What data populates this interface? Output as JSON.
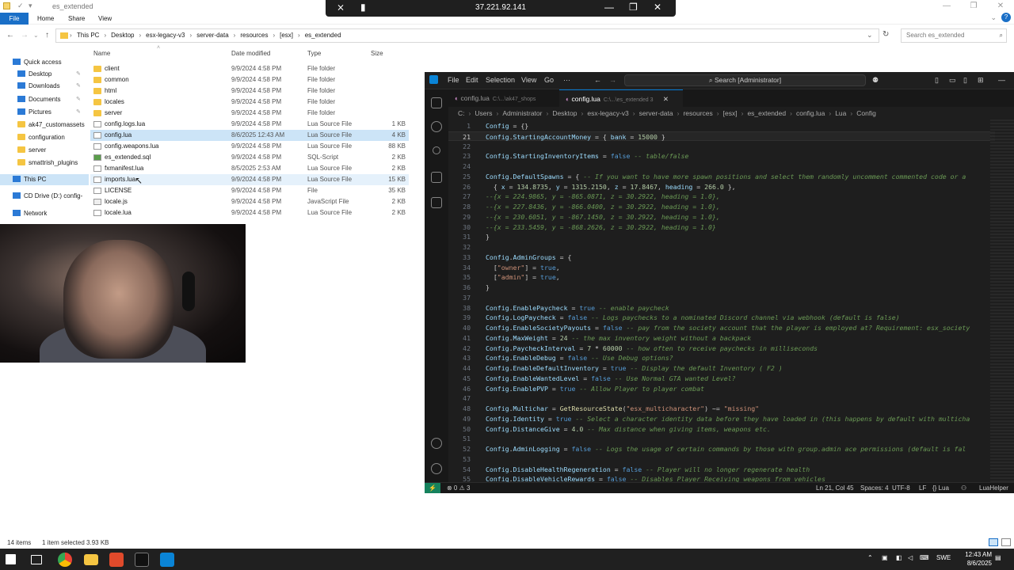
{
  "explorer": {
    "window_title": "es_extended",
    "ribbon_tabs": [
      "File",
      "Home",
      "Share",
      "View"
    ],
    "window_controls": {
      "minimize": "—",
      "restore": "❐",
      "close": "✕"
    },
    "address": {
      "crumbs": [
        "This PC",
        "Desktop",
        "esx-legacy-v3",
        "server-data",
        "resources",
        "[esx]",
        "es_extended"
      ],
      "separator": "›"
    },
    "search_placeholder": "Search es_extended",
    "nav_items": [
      {
        "label": "Quick access",
        "icon": "star-icon"
      },
      {
        "label": "Desktop",
        "icon": "desktop-icon",
        "pinned": true
      },
      {
        "label": "Downloads",
        "icon": "downloads-icon",
        "pinned": true
      },
      {
        "label": "Documents",
        "icon": "documents-icon",
        "pinned": true
      },
      {
        "label": "Pictures",
        "icon": "pictures-icon",
        "pinned": true
      },
      {
        "label": "ak47_customassets",
        "icon": "folder-icon"
      },
      {
        "label": "configuration",
        "icon": "folder-icon"
      },
      {
        "label": "server",
        "icon": "folder-icon"
      },
      {
        "label": "smattrish_plugins",
        "icon": "folder-icon"
      },
      {
        "label": "This PC",
        "icon": "computer-icon"
      },
      {
        "label": "CD Drive (D:) config-",
        "icon": "disc-icon"
      },
      {
        "label": "Network",
        "icon": "network-icon"
      }
    ],
    "columns": {
      "name": "Name",
      "date": "Date modified",
      "type": "Type",
      "size": "Size"
    },
    "files": [
      {
        "name": "client",
        "date": "9/9/2024 4:58 PM",
        "type": "File folder",
        "size": "",
        "icon": "folder-icon"
      },
      {
        "name": "common",
        "date": "9/9/2024 4:58 PM",
        "type": "File folder",
        "size": "",
        "icon": "folder-icon"
      },
      {
        "name": "html",
        "date": "9/9/2024 4:58 PM",
        "type": "File folder",
        "size": "",
        "icon": "folder-icon"
      },
      {
        "name": "locales",
        "date": "9/9/2024 4:58 PM",
        "type": "File folder",
        "size": "",
        "icon": "folder-icon"
      },
      {
        "name": "server",
        "date": "9/9/2024 4:58 PM",
        "type": "File folder",
        "size": "",
        "icon": "folder-icon"
      },
      {
        "name": "config.logs.lua",
        "date": "9/9/2024 4:58 PM",
        "type": "Lua Source File",
        "size": "1 KB",
        "icon": "lua-file-icon"
      },
      {
        "name": "config.lua",
        "date": "8/6/2025 12:43 AM",
        "type": "Lua Source File",
        "size": "4 KB",
        "icon": "lua-file-icon"
      },
      {
        "name": "config.weapons.lua",
        "date": "9/9/2024 4:58 PM",
        "type": "Lua Source File",
        "size": "88 KB",
        "icon": "lua-file-icon"
      },
      {
        "name": "es_extended.sql",
        "date": "9/9/2024 4:58 PM",
        "type": "SQL-Script",
        "size": "2 KB",
        "icon": "sql-file-icon"
      },
      {
        "name": "fxmanifest.lua",
        "date": "8/5/2025 2:53 AM",
        "type": "Lua Source File",
        "size": "2 KB",
        "icon": "lua-file-icon"
      },
      {
        "name": "imports.lua",
        "date": "9/9/2024 4:58 PM",
        "type": "Lua Source File",
        "size": "15 KB",
        "icon": "lua-file-icon"
      },
      {
        "name": "LICENSE",
        "date": "9/9/2024 4:58 PM",
        "type": "File",
        "size": "35 KB",
        "icon": "file-icon"
      },
      {
        "name": "locale.js",
        "date": "9/9/2024 4:58 PM",
        "type": "JavaScript File",
        "size": "2 KB",
        "icon": "js-file-icon"
      },
      {
        "name": "locale.lua",
        "date": "9/9/2024 4:58 PM",
        "type": "Lua Source File",
        "size": "2 KB",
        "icon": "lua-file-icon"
      }
    ],
    "status": {
      "items": "14 items",
      "selected": "1 item selected  3.93 KB"
    }
  },
  "remote": {
    "ip": "37.221.92.141"
  },
  "vscode": {
    "menu": [
      "File",
      "Edit",
      "Selection",
      "View",
      "Go",
      "···"
    ],
    "search": "Search [Administrator]",
    "tabs": [
      {
        "name": "config.lua",
        "path": "C:\\...\\ak47_shops",
        "active": false
      },
      {
        "name": "config.lua",
        "path": "C:\\...\\es_extended 3",
        "active": true
      }
    ],
    "breadcrumb": [
      "C:",
      "Users",
      "Administrator",
      "Desktop",
      "esx-legacy-v3",
      "server-data",
      "resources",
      "[esx]",
      "es_extended",
      "config.lua",
      "Lua",
      "Config"
    ],
    "code_lines": [
      {
        "n": "1",
        "text": "Config = {}"
      },
      {
        "n": "21",
        "text": "Config.StartingAccountMoney = { bank = 15000 }",
        "current": true
      },
      {
        "n": "22",
        "text": ""
      },
      {
        "n": "23",
        "text": "Config.StartingInventoryItems = false -- table/false"
      },
      {
        "n": "24",
        "text": ""
      },
      {
        "n": "25",
        "text": "Config.DefaultSpawns = { -- If you want to have more spawn positions and select them randomly uncomment commented code or a"
      },
      {
        "n": "26",
        "text": "  { x = 134.8735, y = 1315.2150, z = 17.8467, heading = 266.0 },"
      },
      {
        "n": "27",
        "text": "--{x = 224.9865, y = -865.0871, z = 30.2922, heading = 1.0},"
      },
      {
        "n": "28",
        "text": "--{x = 227.8436, y = -866.0400, z = 30.2922, heading = 1.0},"
      },
      {
        "n": "29",
        "text": "--{x = 230.6051, y = -867.1450, z = 30.2922, heading = 1.0},"
      },
      {
        "n": "30",
        "text": "--{x = 233.5459, y = -868.2626, z = 30.2922, heading = 1.0}"
      },
      {
        "n": "31",
        "text": "}"
      },
      {
        "n": "32",
        "text": ""
      },
      {
        "n": "33",
        "text": "Config.AdminGroups = {"
      },
      {
        "n": "34",
        "text": "  [\"owner\"] = true,"
      },
      {
        "n": "35",
        "text": "  [\"admin\"] = true,"
      },
      {
        "n": "36",
        "text": "}"
      },
      {
        "n": "37",
        "text": ""
      },
      {
        "n": "38",
        "text": "Config.EnablePaycheck = true -- enable paycheck"
      },
      {
        "n": "39",
        "text": "Config.LogPaycheck = false -- Logs paychecks to a nominated Discord channel via webhook (default is false)"
      },
      {
        "n": "40",
        "text": "Config.EnableSocietyPayouts = false -- pay from the society account that the player is employed at? Requirement: esx_society"
      },
      {
        "n": "41",
        "text": "Config.MaxWeight = 24 -- the max inventory weight without a backpack"
      },
      {
        "n": "42",
        "text": "Config.PaycheckInterval = 7 * 60000 -- how often to receive paychecks in milliseconds"
      },
      {
        "n": "43",
        "text": "Config.EnableDebug = false -- Use Debug options?"
      },
      {
        "n": "44",
        "text": "Config.EnableDefaultInventory = true -- Display the default Inventory ( F2 )"
      },
      {
        "n": "45",
        "text": "Config.EnableWantedLevel = false -- Use Normal GTA wanted Level?"
      },
      {
        "n": "46",
        "text": "Config.EnablePVP = true -- Allow Player to player combat"
      },
      {
        "n": "47",
        "text": ""
      },
      {
        "n": "48",
        "text": "Config.Multichar = GetResourceState(\"esx_multicharacter\") ~= \"missing\""
      },
      {
        "n": "49",
        "text": "Config.Identity = true -- Select a character identity data before they have loaded in (this happens by default with multicha"
      },
      {
        "n": "50",
        "text": "Config.DistanceGive = 4.0 -- Max distance when giving items, weapons etc."
      },
      {
        "n": "51",
        "text": ""
      },
      {
        "n": "52",
        "text": "Config.AdminLogging = false -- Logs the usage of certain commands by those with group.admin ace permissions (default is fal"
      },
      {
        "n": "53",
        "text": ""
      },
      {
        "n": "54",
        "text": "Config.DisableHealthRegeneration = false -- Player will no longer regenerate health"
      },
      {
        "n": "55",
        "text": "Config.DisableVehicleRewards = false -- Disables Player Receiving weapons from vehicles"
      }
    ],
    "status": {
      "problems": "⊗ 0 ⚠ 3",
      "position": "Ln 21, Col 45",
      "spaces": "Spaces: 4",
      "encoding": "UTF-8",
      "eol": "LF",
      "language": "{} Lua",
      "extension": "LuaHelper"
    }
  },
  "taskbar": {
    "tray": {
      "lang": "SWE"
    },
    "time": "12:43 AM",
    "date": "8/6/2025"
  },
  "colors": {
    "vscode_bg": "#1e1e1e",
    "keyword": "#569cd6",
    "identifier": "#9cdcfe",
    "number": "#b5cea8",
    "string": "#ce9178",
    "comment": "#6a9955",
    "explorer_selection": "#cce4f7",
    "taskbar": "#202020"
  }
}
